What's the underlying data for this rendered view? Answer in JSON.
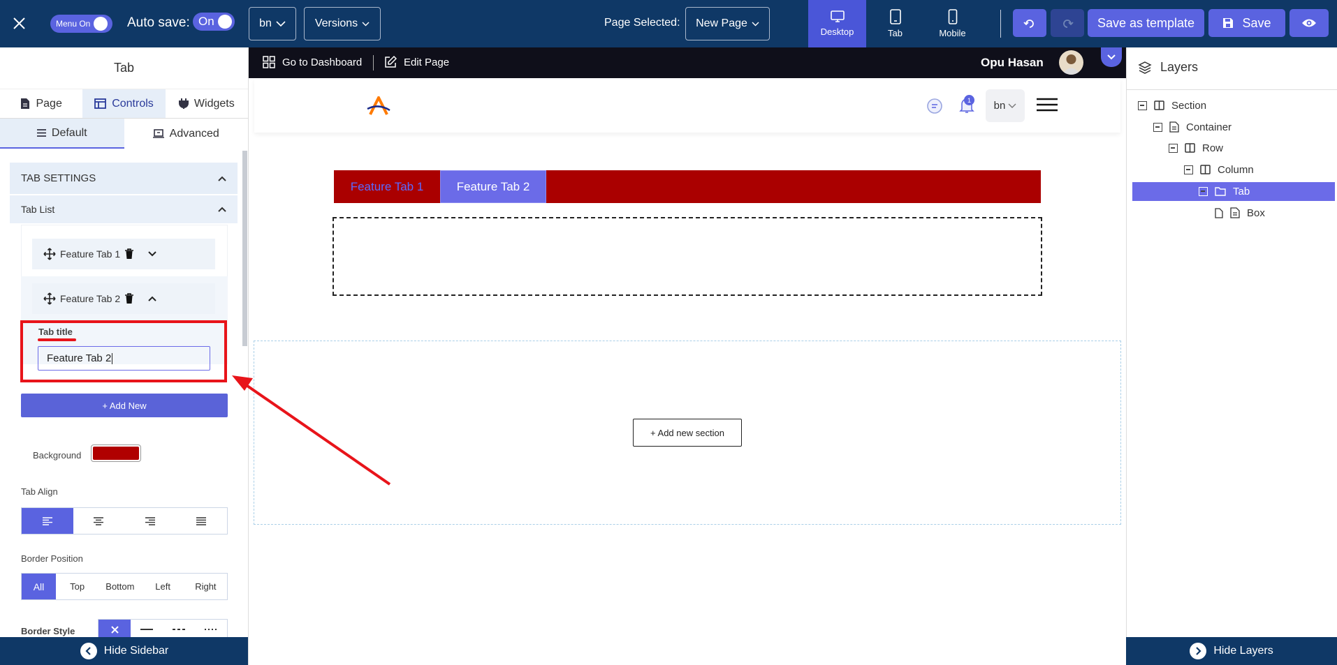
{
  "topbar": {
    "menu_toggle_label": "Menu On",
    "auto_save_label": "Auto save:",
    "auto_save_state": "On",
    "lang_select": "bn",
    "versions_label": "Versions",
    "page_selected_label": "Page Selected:",
    "page_select_value": "New Page",
    "devices": [
      {
        "label": "Desktop",
        "icon": "desktop-icon",
        "active": true
      },
      {
        "label": "Tab",
        "icon": "tablet-icon",
        "active": false
      },
      {
        "label": "Mobile",
        "icon": "mobile-icon",
        "active": false
      }
    ],
    "save_template_label": "Save as template",
    "save_label": "Save"
  },
  "left_panel": {
    "title": "Tab",
    "tabs": [
      "Page",
      "Controls",
      "Widgets"
    ],
    "active_tab": "Controls",
    "subtabs": [
      "Default",
      "Advanced"
    ],
    "active_subtab": "Default",
    "tab_settings_label": "TAB SETTINGS",
    "tab_list_label": "Tab List",
    "tab_items": [
      "Feature Tab 1",
      "Feature Tab 2"
    ],
    "tab_title_label": "Tab title",
    "tab_title_value": "Feature Tab 2",
    "add_new_label": "+ Add New",
    "background_label": "Background",
    "background_color": "#b00000",
    "tab_align_label": "Tab Align",
    "border_position_label": "Border Position",
    "border_positions": [
      "All",
      "Top",
      "Bottom",
      "Left",
      "Right"
    ],
    "border_style_label": "Border Style",
    "hide_sidebar_label": "Hide Sidebar"
  },
  "admin_bar": {
    "dashboard_label": "Go to Dashboard",
    "edit_page_label": "Edit Page",
    "user_name": "Opu Hasan"
  },
  "site": {
    "lang": "bn",
    "notification_count": "1",
    "tabs": [
      "Feature Tab 1",
      "Feature Tab 2"
    ],
    "active_tab": "Feature Tab 2",
    "add_section_label": "+ Add new section",
    "tab_bar_color": "#aa0000",
    "active_tab_color": "#6b6be8"
  },
  "layers": {
    "title": "Layers",
    "items": [
      "Section",
      "Container",
      "Row",
      "Column",
      "Tab",
      "Box"
    ],
    "selected": "Tab",
    "hide_label": "Hide Layers"
  }
}
